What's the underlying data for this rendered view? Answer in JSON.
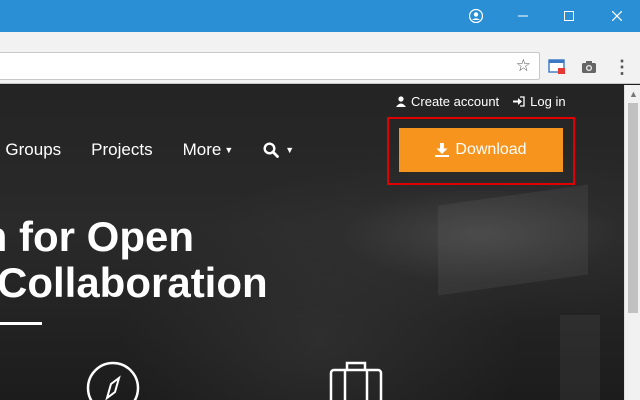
{
  "browser": {
    "url_value": "",
    "icons": {
      "profile": "account-circle-icon",
      "minimize": "minimize-icon",
      "maximize": "maximize-icon",
      "close": "close-icon",
      "bookmark": "star-icon",
      "extension": "cast-extension-icon",
      "screenshot": "camera-icon",
      "menu": "kebab-menu-icon"
    }
  },
  "header": {
    "create_account": "Create account",
    "login": "Log in",
    "nav": {
      "groups": "ing Groups",
      "projects": "Projects",
      "more": "More"
    },
    "download": "Download"
  },
  "hero": {
    "line1": "m for Open",
    "line2": "Collaboration"
  },
  "colors": {
    "titlebar": "#2b8fd6",
    "download": "#f7941d",
    "highlight": "#e00000"
  }
}
